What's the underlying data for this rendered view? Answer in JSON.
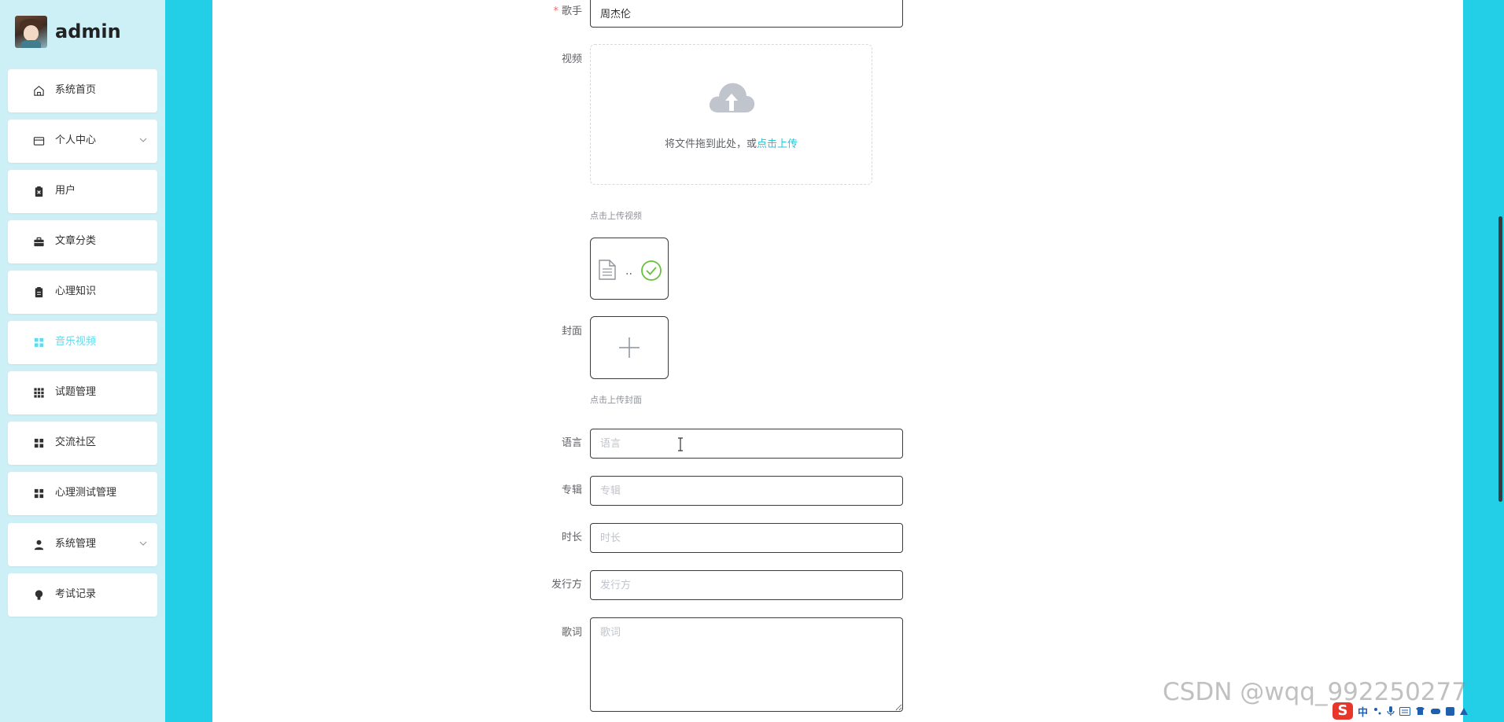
{
  "brand": {
    "name": "admin"
  },
  "sidebar": {
    "items": [
      {
        "label": "系统首页",
        "icon": "home-icon"
      },
      {
        "label": "个人中心",
        "icon": "card-icon"
      },
      {
        "label": "用户",
        "icon": "clipboard-x-icon"
      },
      {
        "label": "文章分类",
        "icon": "briefcase-icon"
      },
      {
        "label": "心理知识",
        "icon": "clipboard-icon"
      },
      {
        "label": "音乐视频",
        "icon": "grid-icon"
      },
      {
        "label": "试题管理",
        "icon": "grid-9-icon"
      },
      {
        "label": "交流社区",
        "icon": "grid-icon"
      },
      {
        "label": "心理测试管理",
        "icon": "grid-icon"
      },
      {
        "label": "系统管理",
        "icon": "user-icon"
      },
      {
        "label": "考试记录",
        "icon": "bulb-icon"
      }
    ],
    "active_color": "#5fdbee"
  },
  "form": {
    "singer": {
      "required_mark": "*",
      "label": "歌手",
      "value": "周杰伦"
    },
    "video": {
      "label": "视频",
      "dropzone_text": "将文件拖到此处，或",
      "dropzone_link": "点击上传",
      "tip": "点击上传视频",
      "file_name": ".."
    },
    "cover": {
      "label": "封面",
      "tip": "点击上传封面"
    },
    "language": {
      "label": "语言",
      "placeholder": "语言"
    },
    "album": {
      "label": "专辑",
      "placeholder": "专辑"
    },
    "duration": {
      "label": "时长",
      "placeholder": "时长"
    },
    "publisher": {
      "label": "发行方",
      "placeholder": "发行方"
    },
    "lyrics": {
      "label": "歌词",
      "placeholder": "歌词"
    }
  },
  "watermark": "CSDN @wqq_992250277",
  "tray": {
    "logo": "S",
    "ime": "中"
  },
  "colors": {
    "accent": "#22cfe6",
    "sidebar_bg": "#cdf0f7",
    "link": "#26c6d6",
    "required": "#f56c6c"
  }
}
